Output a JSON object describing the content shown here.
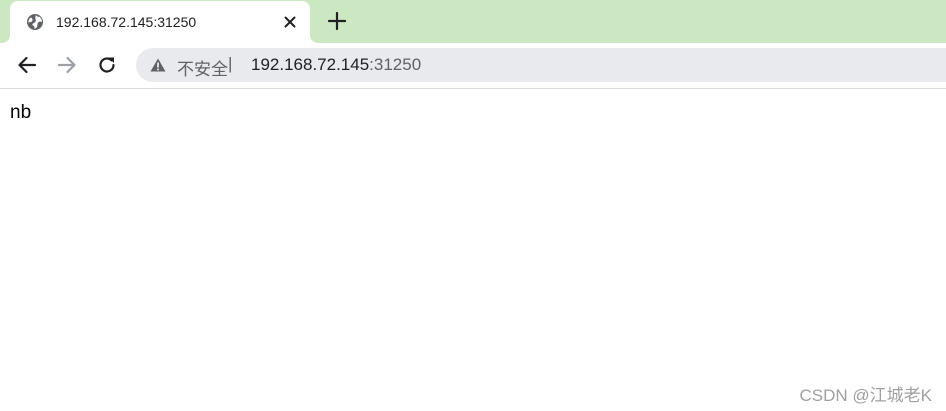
{
  "tab": {
    "title": "192.168.72.145:31250",
    "favicon": "globe-icon"
  },
  "toolbar": {
    "back_icon": "arrow-left-icon",
    "forward_icon": "arrow-right-icon",
    "reload_icon": "reload-icon"
  },
  "omnibox": {
    "security_icon": "warning-triangle-icon",
    "security_label": "不安全",
    "divider": "|",
    "url_host": "192.168.72.145",
    "url_port": ":31250"
  },
  "page": {
    "body_text": "nb"
  },
  "watermark": "CSDN @江城老K",
  "colors": {
    "tabstrip": "#cce8c2",
    "omnibox": "#e8eaed",
    "text": "#202124",
    "muted": "#5f6368"
  }
}
